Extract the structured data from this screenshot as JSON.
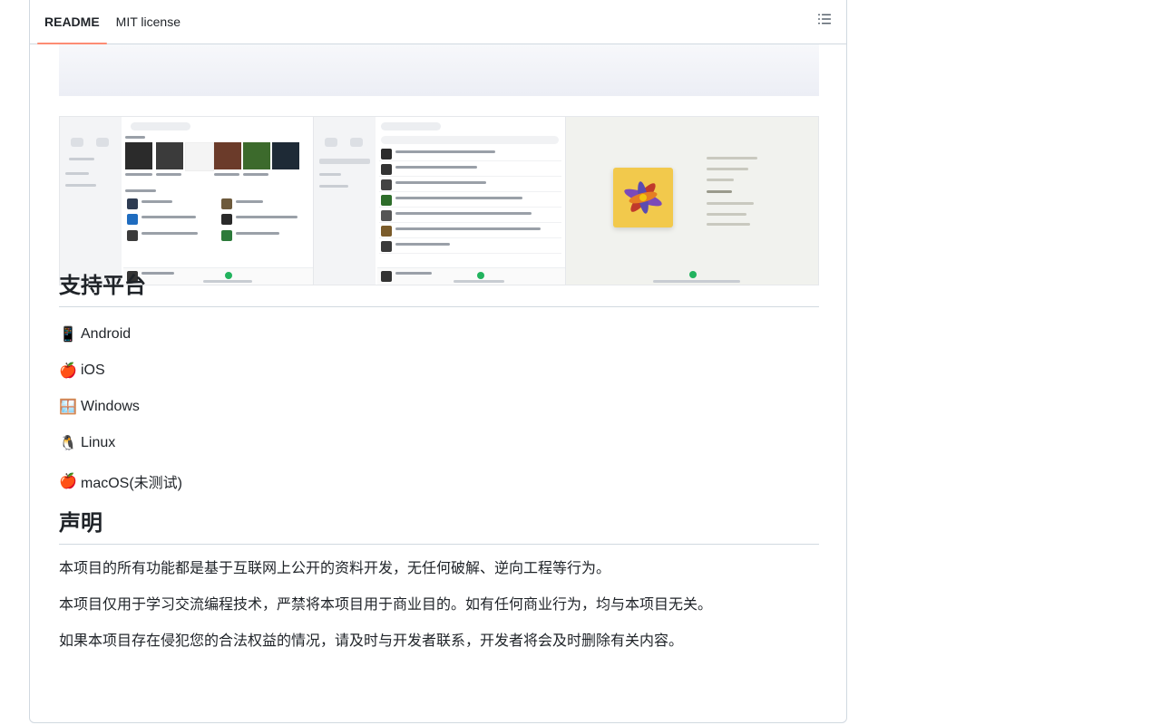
{
  "tabs": [
    {
      "label": "README",
      "active": true
    },
    {
      "label": "MIT license",
      "active": false
    }
  ],
  "toolbar": {
    "outline_icon": "list-unordered-icon"
  },
  "platforms_heading": "支持平台",
  "platforms": [
    {
      "emoji": "📱",
      "label": "Android"
    },
    {
      "emoji": "🍎",
      "label": "iOS"
    },
    {
      "emoji": "🪟",
      "label": "Windows"
    },
    {
      "emoji": "🐧",
      "label": "Linux"
    },
    {
      "emoji": "🍎",
      "label": "macOS(未测试)"
    }
  ],
  "disclaimer_heading": "声明",
  "disclaimer": [
    "本项目的所有功能都是基于互联网上公开的资料开发，无任何破解、逆向工程等行为。",
    "本项目仅用于学习交流编程技术，严禁将本项目用于商业目的。如有任何商业行为，均与本项目无关。",
    "如果本项目存在侵犯您的合法权益的情况，请及时与开发者联系，开发者将会及时删除有关内容。"
  ],
  "colors": {
    "tab_underline": "#fd8c73",
    "border": "#d1d9e0",
    "text": "#1f2328",
    "accent_green": "#22b35e"
  }
}
